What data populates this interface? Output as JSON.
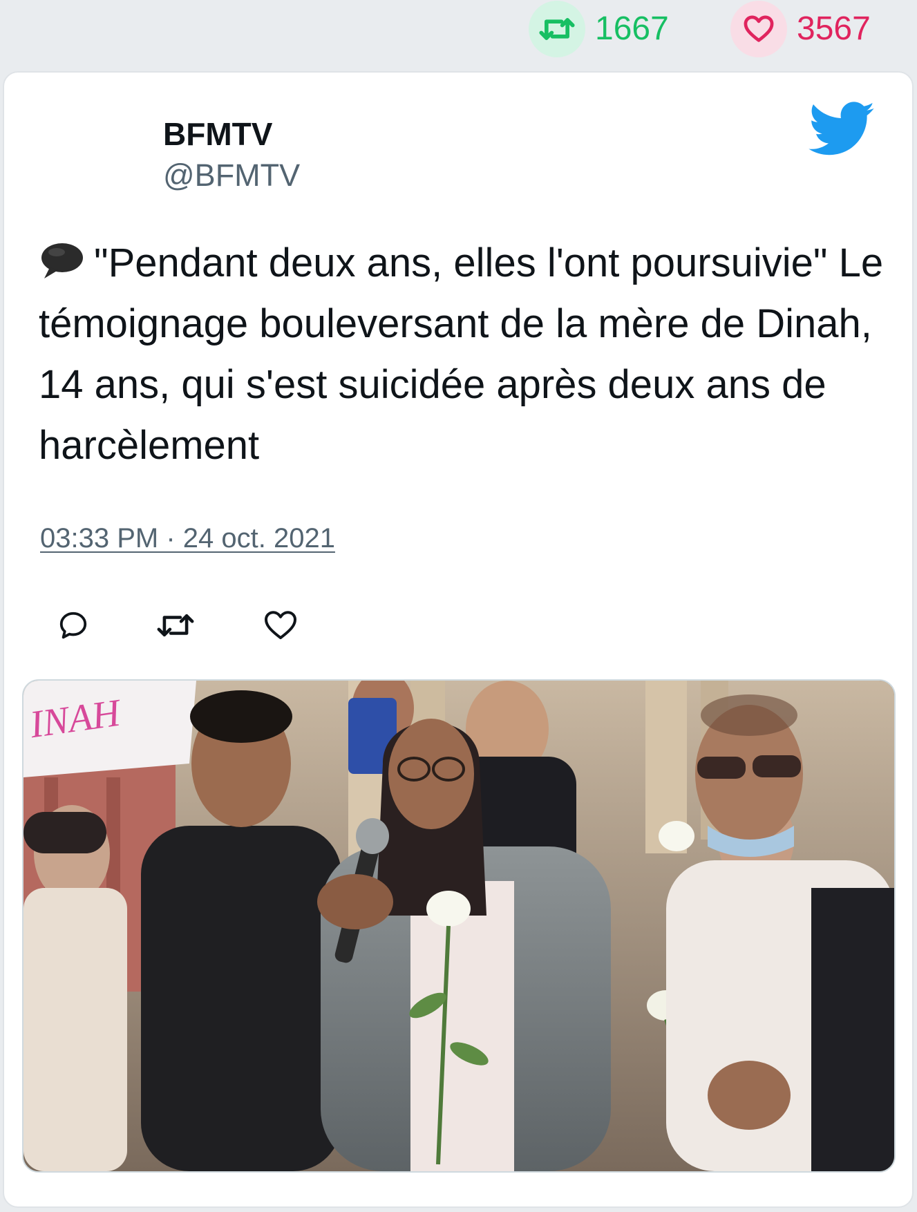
{
  "stats": {
    "retweet_count": "1667",
    "like_count": "3567",
    "retweet_icon": "retweet-icon",
    "like_icon": "heart-icon"
  },
  "tweet": {
    "author_name": "BFMTV",
    "author_handle": "@BFMTV",
    "emoji": "speech-balloon-icon",
    "text": "\"Pendant deux ans, elles l'ont poursuivie\" Le témoignage bouleversant de la mère de Dinah, 14 ans, qui s'est suicidée après deux ans de harcèlement",
    "timestamp": "03:33 PM · 24 oct. 2021",
    "media_sign_text": "INAH"
  },
  "actions": [
    "reply-icon",
    "retweet-icon",
    "heart-icon"
  ],
  "colors": {
    "retweet": "#17bf63",
    "like": "#e0245e",
    "twitter_blue": "#1d9bf0",
    "secondary_text": "#536471"
  }
}
